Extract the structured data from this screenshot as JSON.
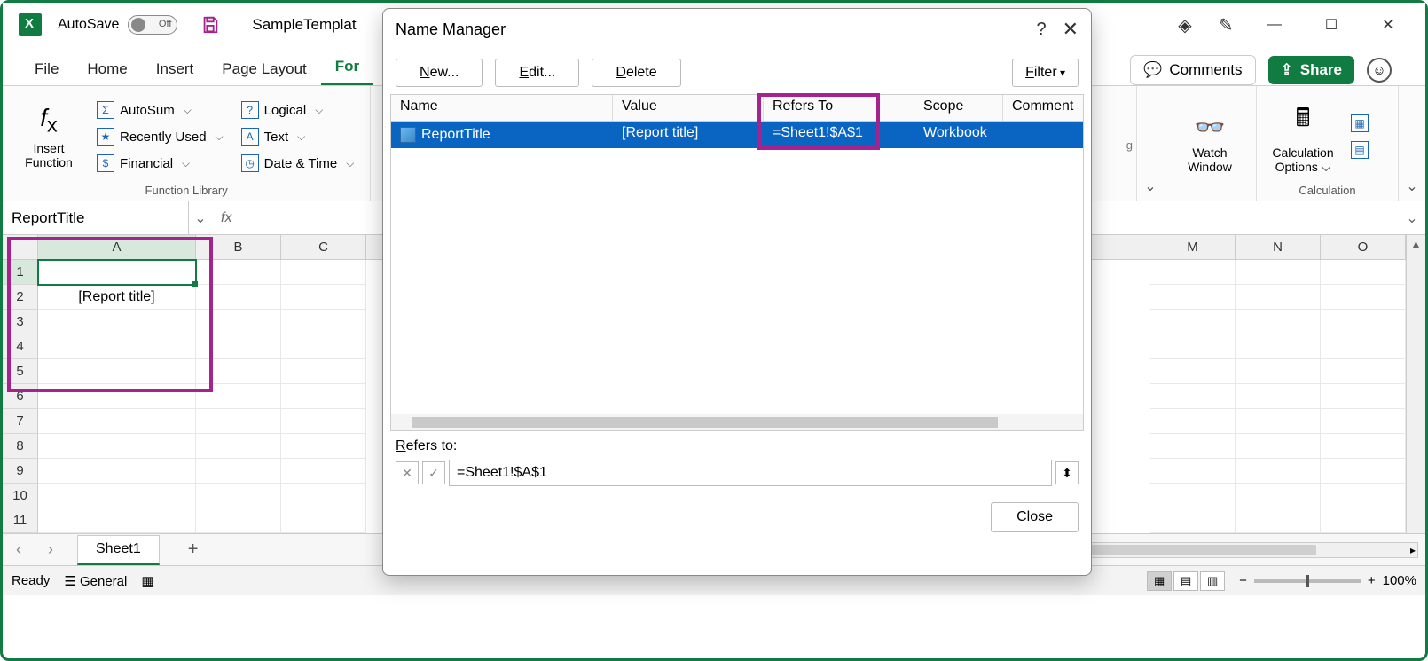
{
  "titlebar": {
    "autosave_label": "AutoSave",
    "autosave_state": "Off",
    "doc_title": "SampleTemplat"
  },
  "tabs": {
    "file": "File",
    "home": "Home",
    "insert": "Insert",
    "page_layout": "Page Layout",
    "formulas": "For"
  },
  "ribbon_right": {
    "comments": "Comments",
    "share": "Share"
  },
  "ribbon": {
    "insert_function": "Insert\nFunction",
    "autosum": "AutoSum",
    "recently_used": "Recently Used",
    "financial": "Financial",
    "logical": "Logical",
    "text": "Text",
    "date_time": "Date & Time",
    "function_library": "Function Library",
    "watch_window": "Watch\nWindow",
    "calc_options": "Calculation\nOptions",
    "calculation": "Calculation"
  },
  "fbar": {
    "namebox": "ReportTitle",
    "formula": ""
  },
  "grid": {
    "columns": [
      "A",
      "B",
      "C",
      "M",
      "N",
      "O"
    ],
    "rows": [
      "1",
      "2",
      "3",
      "4",
      "5",
      "6",
      "7",
      "8",
      "9",
      "10",
      "11"
    ],
    "a2_value": "[Report title]"
  },
  "sheet": {
    "name": "Sheet1"
  },
  "status": {
    "ready": "Ready",
    "general": "General",
    "zoom": "100%"
  },
  "dialog": {
    "title": "Name Manager",
    "btn_new": "New...",
    "btn_edit": "Edit...",
    "btn_delete": "Delete",
    "btn_filter": "Filter",
    "col_name": "Name",
    "col_value": "Value",
    "col_refers": "Refers To",
    "col_scope": "Scope",
    "col_comment": "Comment",
    "row": {
      "name": "ReportTitle",
      "value": "[Report title]",
      "refers": "=Sheet1!$A$1",
      "scope": "Workbook",
      "comment": ""
    },
    "refers_to_label": "Refers to:",
    "refers_to_value": "=Sheet1!$A$1",
    "close": "Close"
  }
}
